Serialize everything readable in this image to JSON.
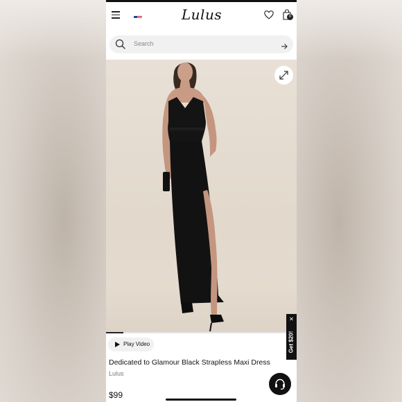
{
  "header": {
    "logo_text": "Lulus",
    "menu_icon": "hamburger-menu-icon",
    "flag_icon": "us-flag-icon",
    "wishlist_icon": "heart-icon",
    "bag_icon": "shopping-bag-icon",
    "bag_count": "0"
  },
  "search": {
    "placeholder": "Search",
    "icon": "search-icon",
    "submit_icon": "arrow-right-icon"
  },
  "gallery": {
    "expand_icon": "expand-icon",
    "progress": 0.09
  },
  "product": {
    "play_video_label": "Play Video",
    "name": "Dedicated to Glamour Black Strapless Maxi Dress",
    "brand": "Lulus",
    "price": "$99"
  },
  "promo": {
    "label": "Get $20!",
    "close_icon": "close-icon"
  },
  "chat": {
    "icon": "chat-headset-icon"
  },
  "colors": {
    "accent": "#111111",
    "background": "#ffffff",
    "search_bg": "#f1f1f1"
  }
}
